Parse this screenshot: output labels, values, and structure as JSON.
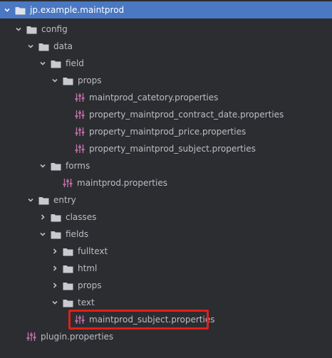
{
  "tree": {
    "root": "jp.example.maintprod",
    "config": "config",
    "data": "data",
    "field": "field",
    "props_1": "props",
    "file_category": "maintprod_catetory.properties",
    "file_contract_date": "property_maintprod_contract_date.properties",
    "file_price": "property_maintprod_price.properties",
    "file_subject_prop": "property_maintprod_subject.properties",
    "forms": "forms",
    "file_maintprod": "maintprod.properties",
    "entry": "entry",
    "classes": "classes",
    "fields": "fields",
    "fulltext": "fulltext",
    "html": "html",
    "props_2": "props",
    "text": "text",
    "file_subject": "maintprod_subject.properties",
    "file_plugin": "plugin.properties"
  },
  "colors": {
    "background": "#2b2d31",
    "selection": "#4a78c2",
    "highlight": "#e0201a",
    "properties_icon": "#c26ea8",
    "folder_icon": "#c8cacf"
  }
}
